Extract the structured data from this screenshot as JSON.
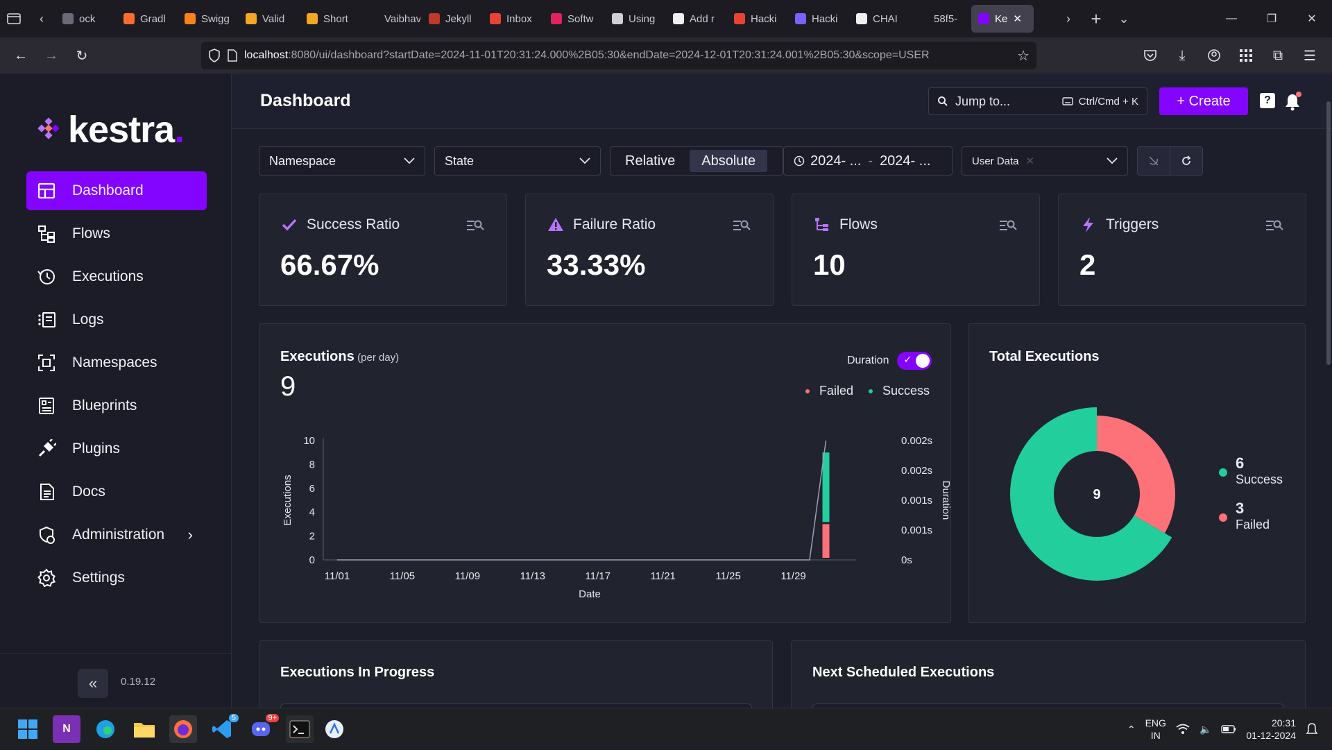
{
  "browser": {
    "tabs": [
      {
        "label": "ock",
        "color": "#6b6b76"
      },
      {
        "label": "Gradl",
        "color": "#ff6b2c"
      },
      {
        "label": "Swigg",
        "color": "#fc8019"
      },
      {
        "label": "Valid",
        "color": "#f5a623"
      },
      {
        "label": "Short",
        "color": "#f5a623"
      },
      {
        "label": "Vaibhav A",
        "color": "#1c1b22"
      },
      {
        "label": "Jekyll",
        "color": "#c0392b"
      },
      {
        "label": "Inbox",
        "color": "#ea4335"
      },
      {
        "label": "Softw",
        "color": "#e0245e"
      },
      {
        "label": "Using",
        "color": "#cfcfd6"
      },
      {
        "label": "Add r",
        "color": "#f0f0f0"
      },
      {
        "label": "Hacki",
        "color": "#ea4335"
      },
      {
        "label": "Hacki",
        "color": "#7b61ff"
      },
      {
        "label": "CHAI",
        "color": "#f0f0f0"
      },
      {
        "label": "58f5-",
        "color": "#1c1b22"
      },
      {
        "label": "Ke",
        "color": "#8405ff"
      }
    ],
    "url_host": "localhost",
    "url_rest": ":8080/ui/dashboard?startDate=2024-11-01T20:31:24.000%2B05:30&endDate=2024-12-01T20:31:24.001%2B05:30&scope=USER"
  },
  "sidebar": {
    "logo_text": "kestra",
    "logo_dot": ".",
    "items": [
      {
        "label": "Dashboard",
        "icon": "dashboard-icon"
      },
      {
        "label": "Flows",
        "icon": "flows-icon"
      },
      {
        "label": "Executions",
        "icon": "history-icon"
      },
      {
        "label": "Logs",
        "icon": "logs-icon"
      },
      {
        "label": "Namespaces",
        "icon": "namespaces-icon"
      },
      {
        "label": "Blueprints",
        "icon": "blueprints-icon"
      },
      {
        "label": "Plugins",
        "icon": "plugins-icon"
      },
      {
        "label": "Docs",
        "icon": "docs-icon"
      },
      {
        "label": "Administration",
        "icon": "administration-icon"
      },
      {
        "label": "Settings",
        "icon": "gear-icon"
      }
    ],
    "collapse_label": "«",
    "version": "0.19.12"
  },
  "topbar": {
    "title": "Dashboard",
    "jump_placeholder": "Jump to...",
    "jump_shortcut": "Ctrl/Cmd + K",
    "create_label": "+ Create",
    "help_label": "?"
  },
  "filters": {
    "namespace": "Namespace",
    "state": "State",
    "relative": "Relative",
    "absolute": "Absolute",
    "date_start": "2024- ...",
    "date_end": "2024- ...",
    "scope": "User Data"
  },
  "stats": [
    {
      "label": "Success Ratio",
      "value": "66.67%",
      "icon": "check-icon",
      "color": "#b873ff"
    },
    {
      "label": "Failure Ratio",
      "value": "33.33%",
      "icon": "warning-icon",
      "color": "#b873ff"
    },
    {
      "label": "Flows",
      "value": "10",
      "icon": "flows-icon",
      "color": "#b873ff"
    },
    {
      "label": "Triggers",
      "value": "2",
      "icon": "lightning-icon",
      "color": "#b873ff"
    }
  ],
  "executions_chart": {
    "title": "Executions",
    "subtitle": "(per day)",
    "total": "9",
    "duration_label": "Duration",
    "legend_failed": "Failed",
    "legend_success": "Success",
    "x_label": "Date",
    "y_label": "Executions",
    "y2_label": "Duration"
  },
  "total_executions": {
    "title": "Total Executions",
    "center": "9",
    "success_count": "6",
    "success_label": "Success",
    "failed_count": "3",
    "failed_label": "Failed"
  },
  "bottom_cards": {
    "in_progress": "Executions In Progress",
    "scheduled": "Next Scheduled Executions"
  },
  "taskbar": {
    "lang1": "ENG",
    "lang2": "IN",
    "time": "20:31",
    "date": "01-12-2024",
    "steam_badge": "5",
    "discord_badge": "9+"
  },
  "colors": {
    "accent": "#8405ff",
    "success": "#21ce9c",
    "failed": "#fd7278"
  },
  "chart_data": [
    {
      "type": "bar",
      "title": "Executions",
      "xlabel": "Date",
      "ylabel": "Executions",
      "y2label": "Duration",
      "x_ticks": [
        "11/01",
        "11/05",
        "11/09",
        "11/13",
        "11/17",
        "11/21",
        "11/25",
        "11/29"
      ],
      "y_ticks": [
        "0",
        "2",
        "4",
        "6",
        "8",
        "10"
      ],
      "y2_ticks": [
        "0s",
        "0.001s",
        "0.001s",
        "0.002s",
        "0.002s"
      ],
      "ylim": [
        0,
        10
      ],
      "categories": [
        "12/01"
      ],
      "series": [
        {
          "name": "Failed",
          "values": [
            3
          ],
          "color": "#fd7278"
        },
        {
          "name": "Success",
          "values": [
            6
          ],
          "color": "#21ce9c"
        }
      ],
      "duration_line": {
        "name": "Duration",
        "points": [
          [
            "11/01",
            0
          ],
          [
            "11/30",
            0
          ],
          [
            "12/01",
            0.002
          ]
        ]
      },
      "legend": "top-right"
    },
    {
      "type": "pie",
      "title": "Total Executions",
      "labels": [
        "Success",
        "Failed"
      ],
      "values": [
        6,
        3
      ],
      "colors": [
        "#21ce9c",
        "#fd7278"
      ],
      "center_label": "9",
      "legend": "right"
    }
  ]
}
